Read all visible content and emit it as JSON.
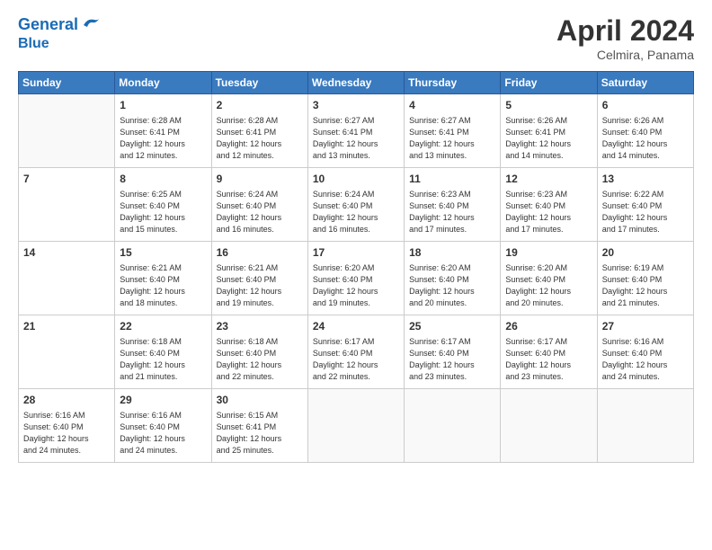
{
  "logo": {
    "line1": "General",
    "line2": "Blue"
  },
  "title": "April 2024",
  "location": "Celmira, Panama",
  "days_of_week": [
    "Sunday",
    "Monday",
    "Tuesday",
    "Wednesday",
    "Thursday",
    "Friday",
    "Saturday"
  ],
  "weeks": [
    [
      {
        "day": "",
        "info": ""
      },
      {
        "day": "1",
        "info": "Sunrise: 6:28 AM\nSunset: 6:41 PM\nDaylight: 12 hours\nand 12 minutes."
      },
      {
        "day": "2",
        "info": "Sunrise: 6:28 AM\nSunset: 6:41 PM\nDaylight: 12 hours\nand 12 minutes."
      },
      {
        "day": "3",
        "info": "Sunrise: 6:27 AM\nSunset: 6:41 PM\nDaylight: 12 hours\nand 13 minutes."
      },
      {
        "day": "4",
        "info": "Sunrise: 6:27 AM\nSunset: 6:41 PM\nDaylight: 12 hours\nand 13 minutes."
      },
      {
        "day": "5",
        "info": "Sunrise: 6:26 AM\nSunset: 6:41 PM\nDaylight: 12 hours\nand 14 minutes."
      },
      {
        "day": "6",
        "info": "Sunrise: 6:26 AM\nSunset: 6:40 PM\nDaylight: 12 hours\nand 14 minutes."
      }
    ],
    [
      {
        "day": "7",
        "info": ""
      },
      {
        "day": "8",
        "info": "Sunrise: 6:25 AM\nSunset: 6:40 PM\nDaylight: 12 hours\nand 15 minutes."
      },
      {
        "day": "9",
        "info": "Sunrise: 6:24 AM\nSunset: 6:40 PM\nDaylight: 12 hours\nand 16 minutes."
      },
      {
        "day": "10",
        "info": "Sunrise: 6:24 AM\nSunset: 6:40 PM\nDaylight: 12 hours\nand 16 minutes."
      },
      {
        "day": "11",
        "info": "Sunrise: 6:23 AM\nSunset: 6:40 PM\nDaylight: 12 hours\nand 17 minutes."
      },
      {
        "day": "12",
        "info": "Sunrise: 6:23 AM\nSunset: 6:40 PM\nDaylight: 12 hours\nand 17 minutes."
      },
      {
        "day": "13",
        "info": "Sunrise: 6:22 AM\nSunset: 6:40 PM\nDaylight: 12 hours\nand 17 minutes."
      }
    ],
    [
      {
        "day": "14",
        "info": ""
      },
      {
        "day": "15",
        "info": "Sunrise: 6:21 AM\nSunset: 6:40 PM\nDaylight: 12 hours\nand 18 minutes."
      },
      {
        "day": "16",
        "info": "Sunrise: 6:21 AM\nSunset: 6:40 PM\nDaylight: 12 hours\nand 19 minutes."
      },
      {
        "day": "17",
        "info": "Sunrise: 6:20 AM\nSunset: 6:40 PM\nDaylight: 12 hours\nand 19 minutes."
      },
      {
        "day": "18",
        "info": "Sunrise: 6:20 AM\nSunset: 6:40 PM\nDaylight: 12 hours\nand 20 minutes."
      },
      {
        "day": "19",
        "info": "Sunrise: 6:20 AM\nSunset: 6:40 PM\nDaylight: 12 hours\nand 20 minutes."
      },
      {
        "day": "20",
        "info": "Sunrise: 6:19 AM\nSunset: 6:40 PM\nDaylight: 12 hours\nand 21 minutes."
      }
    ],
    [
      {
        "day": "21",
        "info": ""
      },
      {
        "day": "22",
        "info": "Sunrise: 6:18 AM\nSunset: 6:40 PM\nDaylight: 12 hours\nand 21 minutes."
      },
      {
        "day": "23",
        "info": "Sunrise: 6:18 AM\nSunset: 6:40 PM\nDaylight: 12 hours\nand 22 minutes."
      },
      {
        "day": "24",
        "info": "Sunrise: 6:17 AM\nSunset: 6:40 PM\nDaylight: 12 hours\nand 22 minutes."
      },
      {
        "day": "25",
        "info": "Sunrise: 6:17 AM\nSunset: 6:40 PM\nDaylight: 12 hours\nand 23 minutes."
      },
      {
        "day": "26",
        "info": "Sunrise: 6:17 AM\nSunset: 6:40 PM\nDaylight: 12 hours\nand 23 minutes."
      },
      {
        "day": "27",
        "info": "Sunrise: 6:16 AM\nSunset: 6:40 PM\nDaylight: 12 hours\nand 24 minutes."
      }
    ],
    [
      {
        "day": "28",
        "info": "Sunrise: 6:16 AM\nSunset: 6:40 PM\nDaylight: 12 hours\nand 24 minutes."
      },
      {
        "day": "29",
        "info": "Sunrise: 6:16 AM\nSunset: 6:40 PM\nDaylight: 12 hours\nand 24 minutes."
      },
      {
        "day": "30",
        "info": "Sunrise: 6:15 AM\nSunset: 6:41 PM\nDaylight: 12 hours\nand 25 minutes."
      },
      {
        "day": "",
        "info": ""
      },
      {
        "day": "",
        "info": ""
      },
      {
        "day": "",
        "info": ""
      },
      {
        "day": "",
        "info": ""
      }
    ]
  ]
}
